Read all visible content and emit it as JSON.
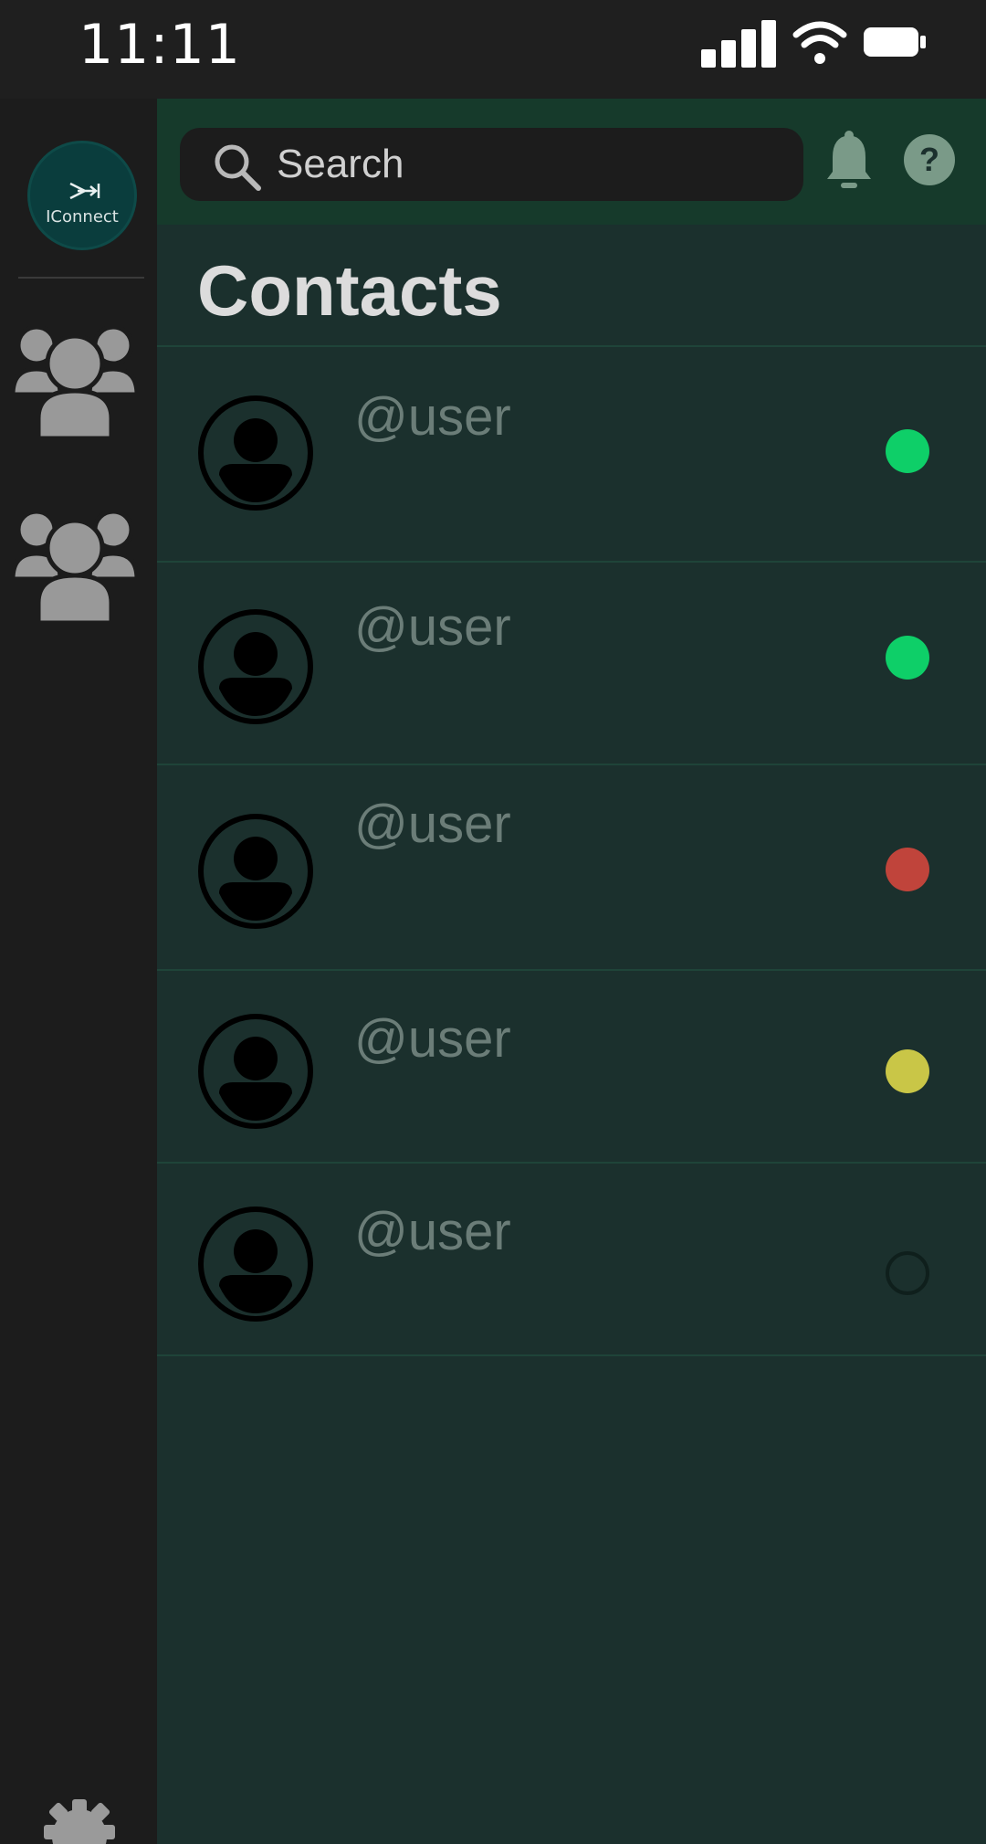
{
  "status_bar": {
    "time": "11:11"
  },
  "rail": {
    "logo_text": "IConnect"
  },
  "search": {
    "placeholder": "Search"
  },
  "page": {
    "title": "Contacts"
  },
  "contacts": [
    {
      "username": "@user",
      "status": "online",
      "status_color": "#0ecf68"
    },
    {
      "username": "@user",
      "status": "online",
      "status_color": "#0ecf68"
    },
    {
      "username": "@user",
      "status": "busy",
      "status_color": "#c0443b"
    },
    {
      "username": "@user",
      "status": "away",
      "status_color": "#c9c647"
    },
    {
      "username": "@user",
      "status": "offline",
      "status_color": "transparent"
    }
  ],
  "colors": {
    "accent": "#163a2b",
    "panel": "#1b302d",
    "rail": "#1c1c1c"
  }
}
